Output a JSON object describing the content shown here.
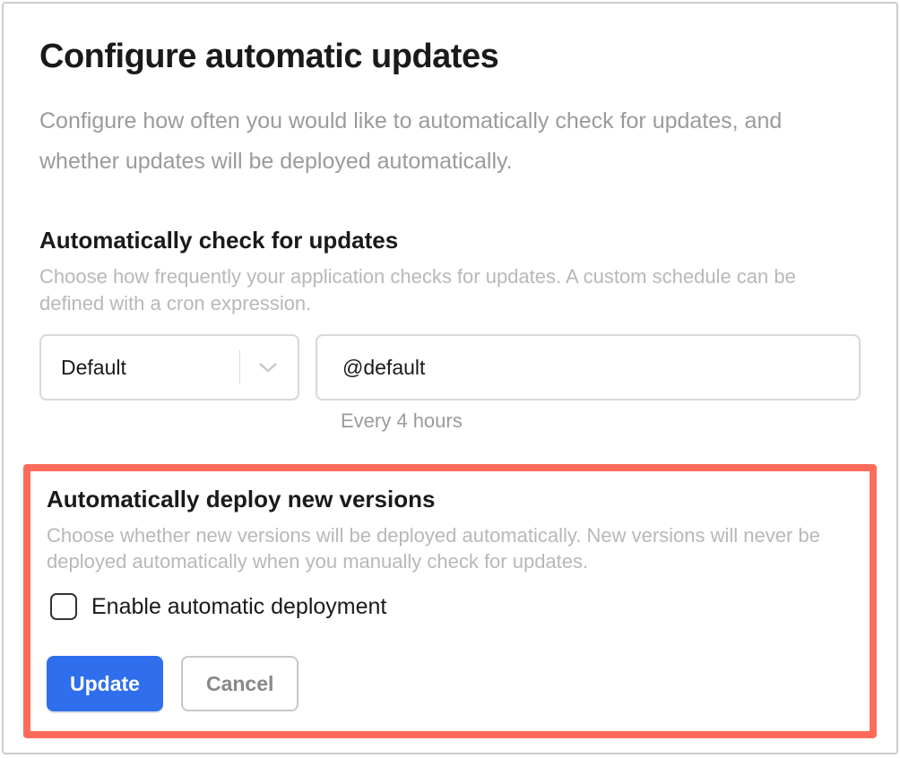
{
  "header": {
    "title": "Configure automatic updates",
    "description": "Configure how often you would like to automatically check for updates, and whether updates will be deployed automatically."
  },
  "check_section": {
    "title": "Automatically check for updates",
    "description": "Choose how frequently your application checks for updates. A custom schedule can be defined with a cron expression.",
    "select_value": "Default",
    "cron_value": "@default",
    "cron_help": "Every 4 hours"
  },
  "deploy_section": {
    "title": "Automatically deploy new versions",
    "description": "Choose whether new versions will be deployed automatically. New versions will never be deployed automatically when you manually check for updates.",
    "checkbox_label": "Enable automatic deployment",
    "checkbox_checked": false
  },
  "buttons": {
    "update": "Update",
    "cancel": "Cancel"
  }
}
